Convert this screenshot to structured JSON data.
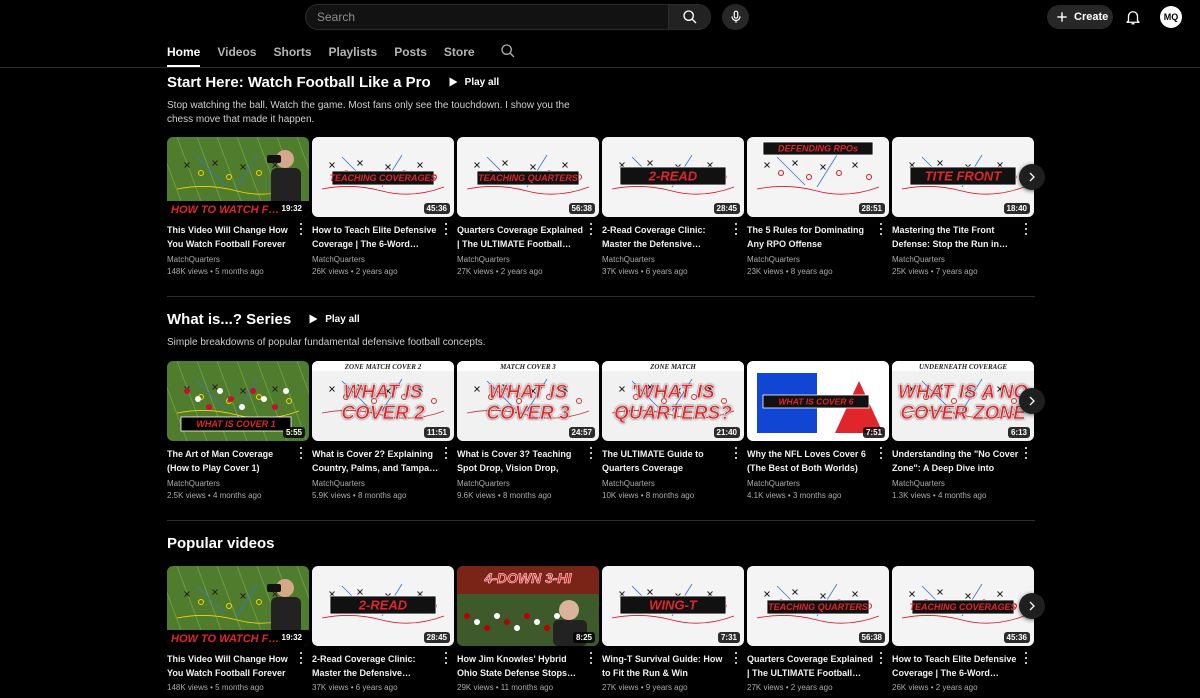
{
  "header": {
    "search_placeholder": "Search",
    "create_label": "Create",
    "avatar_initials": "MQ"
  },
  "tabs": [
    "Home",
    "Videos",
    "Shorts",
    "Playlists",
    "Posts",
    "Store"
  ],
  "shelves": [
    {
      "title": "Start Here: Watch Football Like a Pro",
      "play_all": "Play all",
      "description": "Stop watching the ball. Watch the game. Most fans only see the touchdown. I show you the chess move that made it happen.",
      "videos": [
        {
          "title": "This Video Will Change How You Watch Football Forever …",
          "channel": "MatchQuarters",
          "views": "148K views",
          "age": "5 months ago",
          "duration": "19:32",
          "thumb_text": "HOW TO WATCH F…",
          "style": "field-man"
        },
        {
          "title": "How to Teach Elite Defensive Coverage | The 6-Word…",
          "channel": "MatchQuarters",
          "views": "26K views",
          "age": "2 years ago",
          "duration": "45:36",
          "thumb_text": "TEACHING COVERAGES",
          "style": "white-banner"
        },
        {
          "title": "Quarters Coverage Explained | The ULTIMATE Football…",
          "channel": "MatchQuarters",
          "views": "27K views",
          "age": "2 years ago",
          "duration": "56:38",
          "thumb_text": "TEACHING QUARTERS",
          "style": "white-banner"
        },
        {
          "title": "2-Read Coverage Clinic: Master the Defensive…",
          "channel": "MatchQuarters",
          "views": "37K views",
          "age": "6 years ago",
          "duration": "28:45",
          "thumb_text": "2-READ",
          "style": "white-dark"
        },
        {
          "title": "The 5 Rules for Dominating Any RPO Offense",
          "channel": "MatchQuarters",
          "views": "23K views",
          "age": "8 years ago",
          "duration": "28:51",
          "thumb_text": "DEFENDING RPOs",
          "style": "white-top"
        },
        {
          "title": "Mastering the Tite Front Defense: Stop the Run in…",
          "channel": "MatchQuarters",
          "views": "25K views",
          "age": "7 years ago",
          "duration": "18:40",
          "thumb_text": "TITE FRONT",
          "style": "white-dark"
        }
      ]
    },
    {
      "title": "What is...? Series",
      "play_all": "Play all",
      "description": "Simple breakdowns of popular fundamental defensive football concepts.",
      "videos": [
        {
          "title": "The Art of Man Coverage (How to Play Cover 1)",
          "channel": "MatchQuarters",
          "views": "2.5K views",
          "age": "4 months ago",
          "duration": "5:55",
          "thumb_text": "WHAT IS COVER 1",
          "style": "field-game"
        },
        {
          "title": "What is Cover 2? Explaining Country, Palms, and Tampa…",
          "channel": "MatchQuarters",
          "views": "5.9K views",
          "age": "8 months ago",
          "duration": "11:51",
          "thumb_text": "WHAT IS COVER 2",
          "top_text": "ZONE MATCH COVER 2",
          "style": "big-red"
        },
        {
          "title": "What is Cover 3? Teaching Spot Drop, Vision Drop, and…",
          "channel": "MatchQuarters",
          "views": "9.6K views",
          "age": "8 months ago",
          "duration": "24:57",
          "thumb_text": "WHAT IS COVER 3",
          "top_text": "MATCH COVER 3",
          "style": "big-red"
        },
        {
          "title": "The ULTIMATE Guide to Quarters Coverage (Country…",
          "channel": "MatchQuarters",
          "views": "10K views",
          "age": "8 months ago",
          "duration": "21:40",
          "thumb_text": "'WHAT IS QUARTERS?",
          "top_text": "ZONE MATCH",
          "style": "big-red"
        },
        {
          "title": "Why the NFL Loves Cover 6 (The Best of Both Worlds)",
          "channel": "MatchQuarters",
          "views": "4.1K views",
          "age": "3 months ago",
          "duration": "7:51",
          "thumb_text": "WHAT IS COVER 6",
          "style": "cover6"
        },
        {
          "title": "Understanding the \"No Cover Zone\": A Deep Dive into Zon…",
          "channel": "MatchQuarters",
          "views": "1.3K views",
          "age": "4 months ago",
          "duration": "6:13",
          "thumb_text": "WHAT IS A NO COVER ZONE",
          "top_text": "UNDERNEATH COVERAGE",
          "style": "big-red"
        }
      ]
    },
    {
      "title": "Popular videos",
      "videos": [
        {
          "title": "This Video Will Change How You Watch Football Forever …",
          "channel": "",
          "views": "148K views",
          "age": "5 months ago",
          "duration": "19:32",
          "thumb_text": "HOW TO WATCH F…",
          "style": "field-man"
        },
        {
          "title": "2-Read Coverage Clinic: Master the Defensive…",
          "channel": "",
          "views": "37K views",
          "age": "6 years ago",
          "duration": "28:45",
          "thumb_text": "2-READ",
          "style": "white-dark"
        },
        {
          "title": "How Jim Knowles' Hybrid Ohio State Defense Stops…",
          "channel": "",
          "views": "29K views",
          "age": "11 months ago",
          "duration": "8:25",
          "thumb_text": "4-DOWN 3-HI",
          "style": "stadium"
        },
        {
          "title": "Wing-T Survival Guide: How to Fit the Run & Win",
          "channel": "",
          "views": "27K views",
          "age": "9 years ago",
          "duration": "7:31",
          "thumb_text": "WING-T",
          "style": "white-dark"
        },
        {
          "title": "Quarters Coverage Explained | The ULTIMATE Football…",
          "channel": "",
          "views": "27K views",
          "age": "2 years ago",
          "duration": "56:38",
          "thumb_text": "TEACHING QUARTERS",
          "style": "white-banner"
        },
        {
          "title": "How to Teach Elite Defensive Coverage | The 6-Word…",
          "channel": "",
          "views": "26K views",
          "age": "2 years ago",
          "duration": "45:36",
          "thumb_text": "TEACHING COVERAGES",
          "style": "white-banner"
        }
      ]
    }
  ],
  "colors": {
    "background": "#000000",
    "banner_red": "#e0252b",
    "field_green": "#4f7d2d",
    "banner_blue": "#1146d4"
  }
}
